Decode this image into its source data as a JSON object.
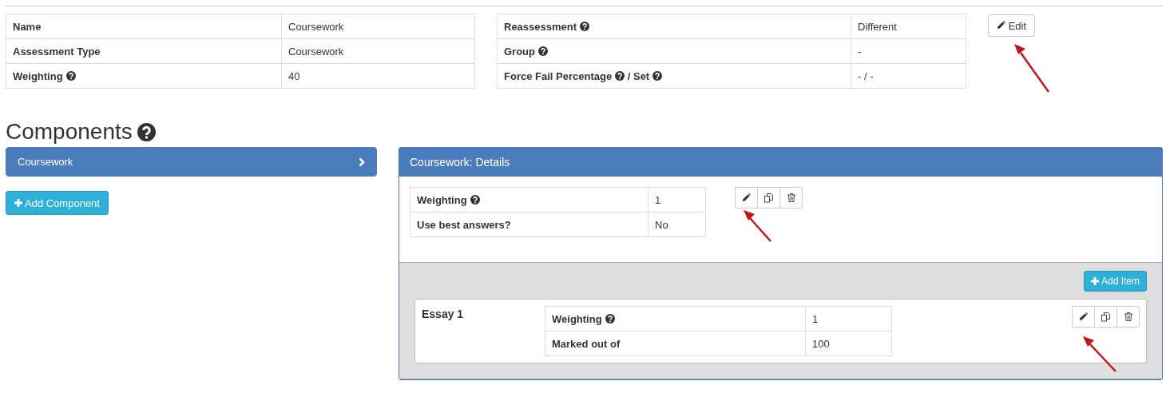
{
  "summary_tables": [
    {
      "rows": [
        {
          "label": [
            {
              "text": "Name",
              "help": false
            }
          ],
          "value": "Coursework"
        },
        {
          "label": [
            {
              "text": "Assessment Type",
              "help": false
            }
          ],
          "value": "Coursework"
        },
        {
          "label": [
            {
              "text": "Weighting",
              "help": true
            }
          ],
          "value": "40"
        }
      ]
    },
    {
      "rows": [
        {
          "label": [
            {
              "text": "Reassessment",
              "help": true
            }
          ],
          "value": "Different"
        },
        {
          "label": [
            {
              "text": "Group",
              "help": true
            }
          ],
          "value": "-"
        },
        {
          "label": [
            {
              "text": "Force Fail Percentage",
              "help": true
            },
            {
              "text": "/ Set",
              "help": true
            }
          ],
          "value": "- / -"
        }
      ]
    }
  ],
  "edit_button": "Edit",
  "heading": {
    "text": "Components",
    "help": true
  },
  "components": [
    {
      "label": "Coursework",
      "selected": true
    }
  ],
  "add_component_button": "Add Component",
  "details": {
    "title": "Coursework: Details",
    "rows": [
      {
        "label": [
          {
            "text": "Weighting",
            "help": true
          }
        ],
        "value": "1"
      },
      {
        "label": [
          {
            "text": "Use best answers?",
            "help": false
          }
        ],
        "value": "No"
      }
    ],
    "add_item_button": "Add Item",
    "items": [
      {
        "name": "Essay 1",
        "rows": [
          {
            "label": [
              {
                "text": "Weighting",
                "help": true
              }
            ],
            "value": "1"
          },
          {
            "label": [
              {
                "text": "Marked out of",
                "help": false
              }
            ],
            "value": "100"
          }
        ]
      }
    ]
  }
}
